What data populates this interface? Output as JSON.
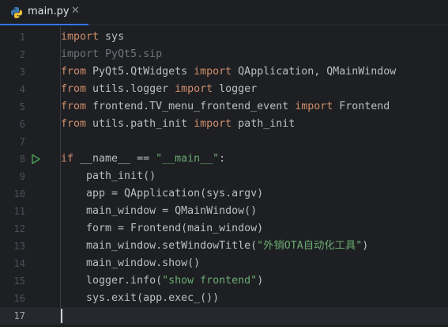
{
  "tab": {
    "filename": "main.py",
    "close_glyph": "✕",
    "icon": "python-icon",
    "accent": "#3574f0"
  },
  "colors": {
    "background": "#1e1f22",
    "keyword": "#cf8e6d",
    "string": "#6aab73",
    "text": "#bcbec4",
    "unused": "#6f737a",
    "line_number": "#4b5059",
    "run_gutter": "#499c54"
  },
  "editor": {
    "current_line": "17",
    "run_icon_line": "8",
    "lines": [
      {
        "n": "1",
        "parts": [
          {
            "t": "import",
            "c": "kw"
          },
          {
            "t": " sys",
            "c": ""
          }
        ]
      },
      {
        "n": "2",
        "parts": [
          {
            "t": "import PyQt5.sip",
            "c": "dim"
          }
        ]
      },
      {
        "n": "3",
        "parts": [
          {
            "t": "from",
            "c": "kw"
          },
          {
            "t": " PyQt5.QtWidgets ",
            "c": ""
          },
          {
            "t": "import",
            "c": "kw"
          },
          {
            "t": " QApplication, QMainWindow",
            "c": ""
          }
        ]
      },
      {
        "n": "4",
        "parts": [
          {
            "t": "from",
            "c": "kw"
          },
          {
            "t": " utils.logger ",
            "c": ""
          },
          {
            "t": "import",
            "c": "kw"
          },
          {
            "t": " logger",
            "c": ""
          }
        ]
      },
      {
        "n": "5",
        "parts": [
          {
            "t": "from",
            "c": "kw"
          },
          {
            "t": " frontend.TV_menu_frontend_event ",
            "c": ""
          },
          {
            "t": "import",
            "c": "kw"
          },
          {
            "t": " Frontend",
            "c": ""
          }
        ]
      },
      {
        "n": "6",
        "parts": [
          {
            "t": "from",
            "c": "kw"
          },
          {
            "t": " utils.path_init ",
            "c": ""
          },
          {
            "t": "import",
            "c": "kw"
          },
          {
            "t": " path_init",
            "c": ""
          }
        ]
      },
      {
        "n": "7",
        "parts": []
      },
      {
        "n": "8",
        "parts": [
          {
            "t": "if",
            "c": "kw"
          },
          {
            "t": " __name__ == ",
            "c": ""
          },
          {
            "t": "\"__main__\"",
            "c": "str"
          },
          {
            "t": ":",
            "c": ""
          }
        ]
      },
      {
        "n": "9",
        "parts": [
          {
            "t": "    path_init()",
            "c": ""
          }
        ]
      },
      {
        "n": "10",
        "parts": [
          {
            "t": "    app = QApplication(sys.argv)",
            "c": ""
          }
        ]
      },
      {
        "n": "11",
        "parts": [
          {
            "t": "    main_window = QMainWindow()",
            "c": ""
          }
        ]
      },
      {
        "n": "12",
        "parts": [
          {
            "t": "    form = Frontend(main_window)",
            "c": ""
          }
        ]
      },
      {
        "n": "13",
        "parts": [
          {
            "t": "    main_window.setWindowTitle(",
            "c": ""
          },
          {
            "t": "\"外销OTA自动化工具\"",
            "c": "str"
          },
          {
            "t": ")",
            "c": ""
          }
        ]
      },
      {
        "n": "14",
        "parts": [
          {
            "t": "    main_window.show()",
            "c": ""
          }
        ]
      },
      {
        "n": "15",
        "parts": [
          {
            "t": "    logger.info(",
            "c": ""
          },
          {
            "t": "\"show frontend\"",
            "c": "str"
          },
          {
            "t": ")",
            "c": ""
          }
        ]
      },
      {
        "n": "16",
        "parts": [
          {
            "t": "    sys.exit(app.exec_())",
            "c": ""
          }
        ]
      },
      {
        "n": "17",
        "parts": []
      }
    ]
  }
}
